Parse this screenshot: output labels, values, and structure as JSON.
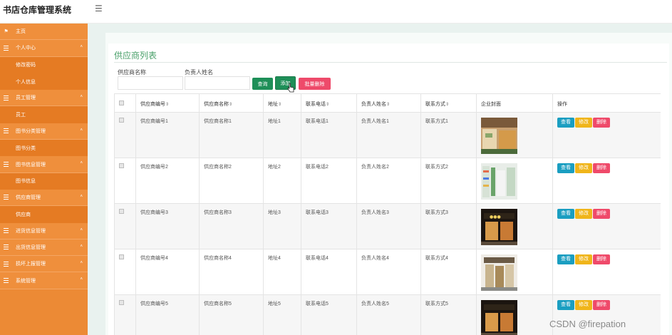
{
  "app": {
    "title": "书店仓库管理系统"
  },
  "sidebar": {
    "items": [
      {
        "label": "主页",
        "type": "home",
        "icon": "flag-icon"
      },
      {
        "label": "个人中心",
        "type": "group"
      },
      {
        "label": "修改密码",
        "type": "sub"
      },
      {
        "label": "个人信息",
        "type": "sub"
      },
      {
        "label": "员工管理",
        "type": "group"
      },
      {
        "label": "员工",
        "type": "sub"
      },
      {
        "label": "图书分类管理",
        "type": "group"
      },
      {
        "label": "图书分类",
        "type": "sub"
      },
      {
        "label": "图书信息管理",
        "type": "group"
      },
      {
        "label": "图书信息",
        "type": "sub"
      },
      {
        "label": "供应商管理",
        "type": "group"
      },
      {
        "label": "供应商",
        "type": "sub"
      },
      {
        "label": "进货信息管理",
        "type": "group"
      },
      {
        "label": "出货信息管理",
        "type": "group"
      },
      {
        "label": "损坏上报管理",
        "type": "group"
      },
      {
        "label": "系统管理",
        "type": "group"
      }
    ]
  },
  "page": {
    "title": "供应商列表"
  },
  "filters": {
    "supplier_name_label": "供应商名称",
    "supplier_name_value": "",
    "contact_person_label": "负责人姓名",
    "contact_person_value": ""
  },
  "buttons": {
    "query": "查询",
    "add": "添加",
    "batch_delete": "批量删除"
  },
  "table": {
    "columns": [
      "供应商编号",
      "供应商名称",
      "地址",
      "联系电话",
      "负责人姓名",
      "联系方式",
      "企业封面",
      "操作"
    ],
    "sortable": [
      true,
      true,
      true,
      true,
      true,
      true,
      false,
      false
    ],
    "rows": [
      {
        "id": "供应商编号1",
        "name": "供应商名称1",
        "address": "地址1",
        "phone": "联系电话1",
        "contact": "负责人姓名1",
        "method": "联系方式1"
      },
      {
        "id": "供应商编号2",
        "name": "供应商名称2",
        "address": "地址2",
        "phone": "联系电话2",
        "contact": "负责人姓名2",
        "method": "联系方式2"
      },
      {
        "id": "供应商编号3",
        "name": "供应商名称3",
        "address": "地址3",
        "phone": "联系电话3",
        "contact": "负责人姓名3",
        "method": "联系方式3"
      },
      {
        "id": "供应商编号4",
        "name": "供应商名称4",
        "address": "地址4",
        "phone": "联系电话4",
        "contact": "负责人姓名4",
        "method": "联系方式4"
      },
      {
        "id": "供应商编号5",
        "name": "供应商名称5",
        "address": "地址5",
        "phone": "联系电话5",
        "contact": "负责人姓名5",
        "method": "联系方式5"
      }
    ],
    "row_actions": {
      "view": "查看",
      "edit": "修改",
      "delete": "删除"
    }
  },
  "watermark": "CSDN @firepation",
  "colors": {
    "sidebar": "#ec8a35",
    "accent_green": "#1e8f58",
    "title_green": "#4aa06a",
    "danger": "#ef4a6a",
    "info": "#1a9ec1",
    "warning": "#f0b51a"
  }
}
